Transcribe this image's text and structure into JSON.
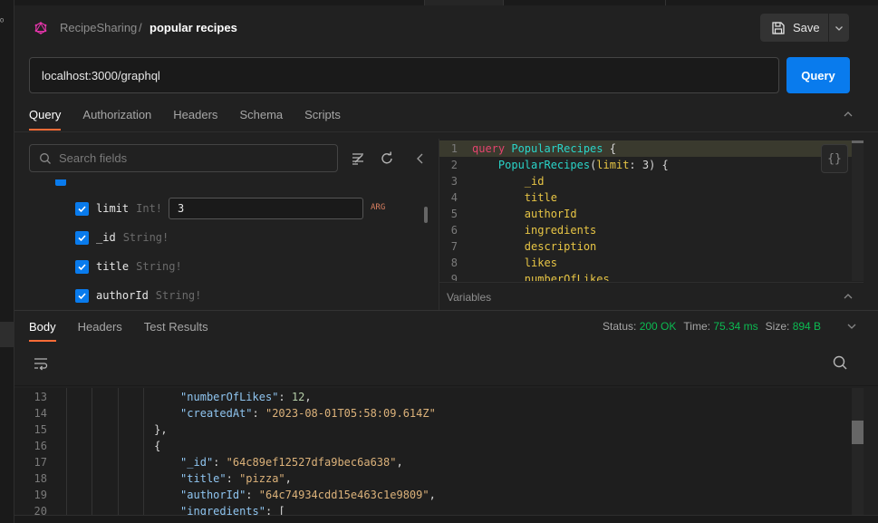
{
  "sidebar": {
    "glyph": "ᵒ"
  },
  "header": {
    "collection": "RecipeSharing",
    "separator": "/",
    "request_name": "popular recipes",
    "save_label": "Save"
  },
  "url_bar": {
    "value": "localhost:3000/graphql",
    "button_label": "Query"
  },
  "request_tabs": [
    {
      "label": "Query",
      "active": true
    },
    {
      "label": "Authorization",
      "active": false
    },
    {
      "label": "Headers",
      "active": false
    },
    {
      "label": "Schema",
      "active": false
    },
    {
      "label": "Scripts",
      "active": false
    }
  ],
  "explorer": {
    "search_placeholder": "Search fields",
    "fields": [
      {
        "name": "limit",
        "type": "Int!",
        "value": "3",
        "tag": "ARG"
      },
      {
        "name": "_id",
        "type": "String!"
      },
      {
        "name": "title",
        "type": "String!"
      },
      {
        "name": "authorId",
        "type": "String!"
      }
    ]
  },
  "editor": {
    "braces_label": "{}",
    "lines": [
      {
        "n": "1",
        "parts": [
          [
            "kw",
            "query"
          ],
          [
            "tx",
            " "
          ],
          [
            "op",
            "PopularRecipes"
          ],
          [
            "tx",
            " {"
          ]
        ]
      },
      {
        "n": "2",
        "parts": [
          [
            "tx",
            "    "
          ],
          [
            "op",
            "PopularRecipes"
          ],
          [
            "tx",
            "("
          ],
          [
            "fd",
            "limit"
          ],
          [
            "tx",
            ": 3) {"
          ]
        ]
      },
      {
        "n": "3",
        "parts": [
          [
            "tx",
            "        "
          ],
          [
            "fd",
            "_id"
          ]
        ]
      },
      {
        "n": "4",
        "parts": [
          [
            "tx",
            "        "
          ],
          [
            "fd",
            "title"
          ]
        ]
      },
      {
        "n": "5",
        "parts": [
          [
            "tx",
            "        "
          ],
          [
            "fd",
            "authorId"
          ]
        ]
      },
      {
        "n": "6",
        "parts": [
          [
            "tx",
            "        "
          ],
          [
            "fd",
            "ingredients"
          ]
        ]
      },
      {
        "n": "7",
        "parts": [
          [
            "tx",
            "        "
          ],
          [
            "fd",
            "description"
          ]
        ]
      },
      {
        "n": "8",
        "parts": [
          [
            "tx",
            "        "
          ],
          [
            "fd",
            "likes"
          ]
        ]
      },
      {
        "n": "9",
        "parts": [
          [
            "tx",
            "        "
          ],
          [
            "fd",
            "numberOfLikes"
          ]
        ]
      }
    ],
    "variables_label": "Variables"
  },
  "response_tabs": [
    {
      "label": "Body",
      "active": true
    },
    {
      "label": "Headers",
      "active": false
    },
    {
      "label": "Test Results",
      "active": false
    }
  ],
  "status": {
    "status_label": "Status:",
    "status_value": "200 OK",
    "time_label": "Time:",
    "time_value": "75.34 ms",
    "size_label": "Size:",
    "size_value": "894 B"
  },
  "response": {
    "lines": [
      {
        "n": "13",
        "parts": [
          [
            "pun",
            "                  "
          ],
          [
            "key",
            "\"numberOfLikes\""
          ],
          [
            "pun",
            ": "
          ],
          [
            "num",
            "12"
          ],
          [
            "pun",
            ","
          ]
        ]
      },
      {
        "n": "14",
        "parts": [
          [
            "pun",
            "                  "
          ],
          [
            "key",
            "\"createdAt\""
          ],
          [
            "pun",
            ": "
          ],
          [
            "str",
            "\"2023-08-01T05:58:09.614Z\""
          ]
        ]
      },
      {
        "n": "15",
        "parts": [
          [
            "pun",
            "              },"
          ]
        ]
      },
      {
        "n": "16",
        "parts": [
          [
            "pun",
            "              {"
          ]
        ]
      },
      {
        "n": "17",
        "parts": [
          [
            "pun",
            "                  "
          ],
          [
            "key",
            "\"_id\""
          ],
          [
            "pun",
            ": "
          ],
          [
            "str",
            "\"64c89ef12527dfa9bec6a638\""
          ],
          [
            "pun",
            ","
          ]
        ]
      },
      {
        "n": "18",
        "parts": [
          [
            "pun",
            "                  "
          ],
          [
            "key",
            "\"title\""
          ],
          [
            "pun",
            ": "
          ],
          [
            "str",
            "\"pizza\""
          ],
          [
            "pun",
            ","
          ]
        ]
      },
      {
        "n": "19",
        "parts": [
          [
            "pun",
            "                  "
          ],
          [
            "key",
            "\"authorId\""
          ],
          [
            "pun",
            ": "
          ],
          [
            "str",
            "\"64c74934cdd15e463c1e9809\""
          ],
          [
            "pun",
            ","
          ]
        ]
      },
      {
        "n": "20",
        "parts": [
          [
            "pun",
            "                  "
          ],
          [
            "key",
            "\"ingredients\""
          ],
          [
            "pun",
            ": ["
          ]
        ]
      }
    ]
  },
  "colors": {
    "accent_tab": "#ff6c37",
    "primary_button": "#097bed",
    "status_ok": "#0cbb52",
    "keyword": "#e4446e",
    "operation": "#2ad4c8",
    "field": "#e7c545"
  }
}
